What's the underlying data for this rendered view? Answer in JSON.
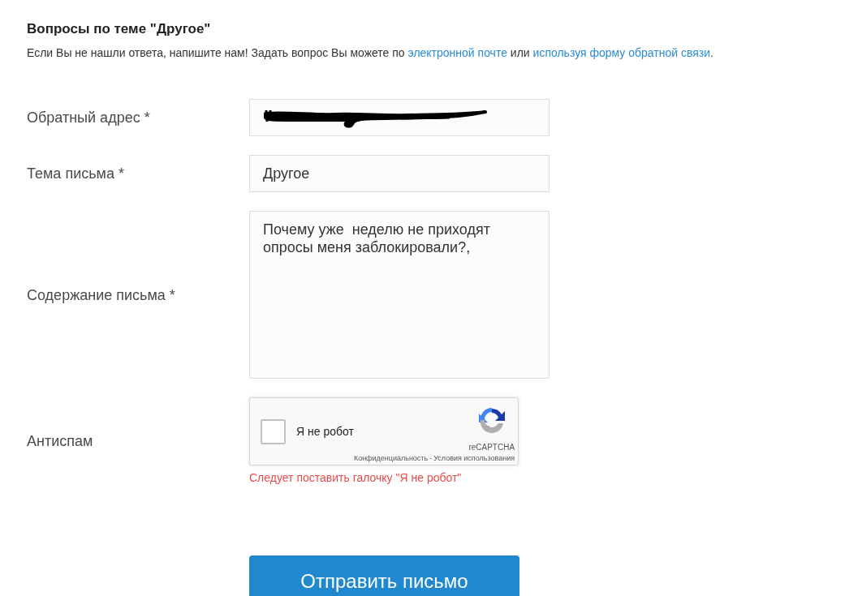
{
  "heading": "Вопросы по теме \"Другое\"",
  "intro": [
    {
      "kind": "text",
      "text": "Если Вы не нашли ответа, напишите нам! Задать вопрос Вы можете по "
    },
    {
      "kind": "link",
      "text": "электронной почте"
    },
    {
      "kind": "text",
      "text": " или "
    },
    {
      "kind": "link",
      "text": "используя форму обратной связи"
    },
    {
      "kind": "text",
      "text": "."
    }
  ],
  "form": {
    "fields": [
      {
        "kind": "input",
        "label": "Обратный адрес *",
        "redacted": true
      },
      {
        "kind": "input",
        "label": "Тема письма *",
        "value": "Другое"
      },
      {
        "kind": "textarea",
        "label": "Содержание письма *",
        "value": "Почему уже  неделю не приходят опросы меня заблокировали?,"
      },
      {
        "kind": "captcha",
        "label": "Антиспам",
        "checkbox_label": "Я не робот",
        "checked": false,
        "brand": "reCAPTCHA",
        "footer_links": [
          "Конфиденциальность",
          "Условия использования"
        ],
        "footer_separator": "-",
        "error": "Следует поставить галочку \"Я не робот\""
      }
    ],
    "submit": "Отправить письмо"
  }
}
